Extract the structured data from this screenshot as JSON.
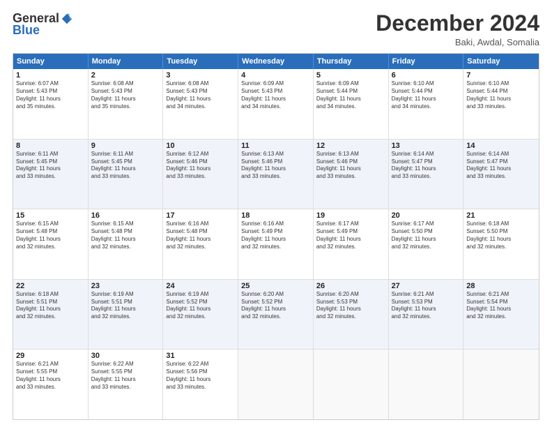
{
  "logo": {
    "general": "General",
    "blue": "Blue"
  },
  "title": "December 2024",
  "location": "Baki, Awdal, Somalia",
  "days_of_week": [
    "Sunday",
    "Monday",
    "Tuesday",
    "Wednesday",
    "Thursday",
    "Friday",
    "Saturday"
  ],
  "weeks": [
    [
      {
        "day": "1",
        "info": "Sunrise: 6:07 AM\nSunset: 5:43 PM\nDaylight: 11 hours\nand 35 minutes."
      },
      {
        "day": "2",
        "info": "Sunrise: 6:08 AM\nSunset: 5:43 PM\nDaylight: 11 hours\nand 35 minutes."
      },
      {
        "day": "3",
        "info": "Sunrise: 6:08 AM\nSunset: 5:43 PM\nDaylight: 11 hours\nand 34 minutes."
      },
      {
        "day": "4",
        "info": "Sunrise: 6:09 AM\nSunset: 5:43 PM\nDaylight: 11 hours\nand 34 minutes."
      },
      {
        "day": "5",
        "info": "Sunrise: 6:09 AM\nSunset: 5:44 PM\nDaylight: 11 hours\nand 34 minutes."
      },
      {
        "day": "6",
        "info": "Sunrise: 6:10 AM\nSunset: 5:44 PM\nDaylight: 11 hours\nand 34 minutes."
      },
      {
        "day": "7",
        "info": "Sunrise: 6:10 AM\nSunset: 5:44 PM\nDaylight: 11 hours\nand 33 minutes."
      }
    ],
    [
      {
        "day": "8",
        "info": "Sunrise: 6:11 AM\nSunset: 5:45 PM\nDaylight: 11 hours\nand 33 minutes."
      },
      {
        "day": "9",
        "info": "Sunrise: 6:11 AM\nSunset: 5:45 PM\nDaylight: 11 hours\nand 33 minutes."
      },
      {
        "day": "10",
        "info": "Sunrise: 6:12 AM\nSunset: 5:46 PM\nDaylight: 11 hours\nand 33 minutes."
      },
      {
        "day": "11",
        "info": "Sunrise: 6:13 AM\nSunset: 5:46 PM\nDaylight: 11 hours\nand 33 minutes."
      },
      {
        "day": "12",
        "info": "Sunrise: 6:13 AM\nSunset: 5:46 PM\nDaylight: 11 hours\nand 33 minutes."
      },
      {
        "day": "13",
        "info": "Sunrise: 6:14 AM\nSunset: 5:47 PM\nDaylight: 11 hours\nand 33 minutes."
      },
      {
        "day": "14",
        "info": "Sunrise: 6:14 AM\nSunset: 5:47 PM\nDaylight: 11 hours\nand 33 minutes."
      }
    ],
    [
      {
        "day": "15",
        "info": "Sunrise: 6:15 AM\nSunset: 5:48 PM\nDaylight: 11 hours\nand 32 minutes."
      },
      {
        "day": "16",
        "info": "Sunrise: 6:15 AM\nSunset: 5:48 PM\nDaylight: 11 hours\nand 32 minutes."
      },
      {
        "day": "17",
        "info": "Sunrise: 6:16 AM\nSunset: 5:48 PM\nDaylight: 11 hours\nand 32 minutes."
      },
      {
        "day": "18",
        "info": "Sunrise: 6:16 AM\nSunset: 5:49 PM\nDaylight: 11 hours\nand 32 minutes."
      },
      {
        "day": "19",
        "info": "Sunrise: 6:17 AM\nSunset: 5:49 PM\nDaylight: 11 hours\nand 32 minutes."
      },
      {
        "day": "20",
        "info": "Sunrise: 6:17 AM\nSunset: 5:50 PM\nDaylight: 11 hours\nand 32 minutes."
      },
      {
        "day": "21",
        "info": "Sunrise: 6:18 AM\nSunset: 5:50 PM\nDaylight: 11 hours\nand 32 minutes."
      }
    ],
    [
      {
        "day": "22",
        "info": "Sunrise: 6:18 AM\nSunset: 5:51 PM\nDaylight: 11 hours\nand 32 minutes."
      },
      {
        "day": "23",
        "info": "Sunrise: 6:19 AM\nSunset: 5:51 PM\nDaylight: 11 hours\nand 32 minutes."
      },
      {
        "day": "24",
        "info": "Sunrise: 6:19 AM\nSunset: 5:52 PM\nDaylight: 11 hours\nand 32 minutes."
      },
      {
        "day": "25",
        "info": "Sunrise: 6:20 AM\nSunset: 5:52 PM\nDaylight: 11 hours\nand 32 minutes."
      },
      {
        "day": "26",
        "info": "Sunrise: 6:20 AM\nSunset: 5:53 PM\nDaylight: 11 hours\nand 32 minutes."
      },
      {
        "day": "27",
        "info": "Sunrise: 6:21 AM\nSunset: 5:53 PM\nDaylight: 11 hours\nand 32 minutes."
      },
      {
        "day": "28",
        "info": "Sunrise: 6:21 AM\nSunset: 5:54 PM\nDaylight: 11 hours\nand 32 minutes."
      }
    ],
    [
      {
        "day": "29",
        "info": "Sunrise: 6:21 AM\nSunset: 5:55 PM\nDaylight: 11 hours\nand 33 minutes."
      },
      {
        "day": "30",
        "info": "Sunrise: 6:22 AM\nSunset: 5:55 PM\nDaylight: 11 hours\nand 33 minutes."
      },
      {
        "day": "31",
        "info": "Sunrise: 6:22 AM\nSunset: 5:56 PM\nDaylight: 11 hours\nand 33 minutes."
      },
      {
        "day": "",
        "info": ""
      },
      {
        "day": "",
        "info": ""
      },
      {
        "day": "",
        "info": ""
      },
      {
        "day": "",
        "info": ""
      }
    ]
  ],
  "alt_rows": [
    1,
    3
  ]
}
